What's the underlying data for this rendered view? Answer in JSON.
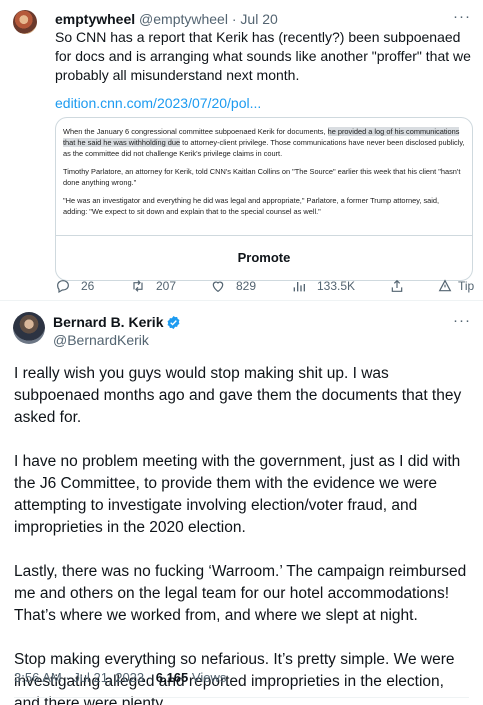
{
  "quoted_tweet": {
    "display_name": "emptywheel",
    "handle": "@emptywheel",
    "separator": "·",
    "date": "Jul 20",
    "more": "···",
    "text": "So CNN has a report that Kerik has (recently?) been subpoenaed for docs and is arranging what sounds like another \"proffer\" that we probably all misunderstand next month.",
    "link": "edition.cnn.com/2023/07/20/pol...",
    "card": {
      "p1_a": "When the January 6 congressional committee subpoenaed Kerik for documents, ",
      "p1_hl": "he provided a log of his communications that he said he was withholding due",
      "p1_b": " to attorney-client privilege. Those communications have never been disclosed publicly, as the committee did not challenge Kerik's privilege claims in court.",
      "p2": "Timothy Parlatore, an attorney for Kerik, told CNN's Kaitlan Collins on \"The Source\" earlier this week that his client \"hasn't done anything wrong.\"",
      "p3": "\"He was an investigator and everything he did was legal and appropriate,\" Parlatore, a former Trump attorney, said, adding: \"We expect to sit down and explain that to the special counsel as well.\""
    },
    "promote_label": "Promote",
    "actions": {
      "replies": "26",
      "retweets": "207",
      "likes": "829",
      "views": "133.5K",
      "tip": "Tip"
    }
  },
  "main_tweet": {
    "display_name": "Bernard B. Kerik",
    "handle": "@BernardKerik",
    "more": "···",
    "paragraphs": [
      "I really wish you guys would stop making shit up. I was subpoenaed months ago and gave them the documents that they asked for.",
      "I have no problem meeting with the government, just as I did with the J6 Committee, to provide them with the evidence we were attempting to investigate involving election/voter fraud, and improprieties in the 2020 election.",
      "Lastly, there was no fucking  ‘Warroom.’ The campaign reimbursed me and others on the legal team for our hotel accommodations! That’s where we worked from, and where we slept at night.",
      "Stop making everything so nefarious. It’s pretty simple. We were investigating alleged and reported improprieties in the election, and there were plenty."
    ],
    "time": "3:56 AM",
    "separator": "·",
    "date": "Jul 21, 2023",
    "views_count": "6,165",
    "views_label": "Views"
  },
  "icons": {
    "reply": "reply-icon",
    "retweet": "retweet-icon",
    "like": "heart-icon",
    "views": "analytics-icon",
    "share": "share-icon",
    "tip": "tip-icon",
    "verified": "verified-badge-icon"
  },
  "colors": {
    "link": "#1d9bf0",
    "secondary_text": "#536471",
    "border": "#cfd9de",
    "verified": "#1d9bf0"
  }
}
